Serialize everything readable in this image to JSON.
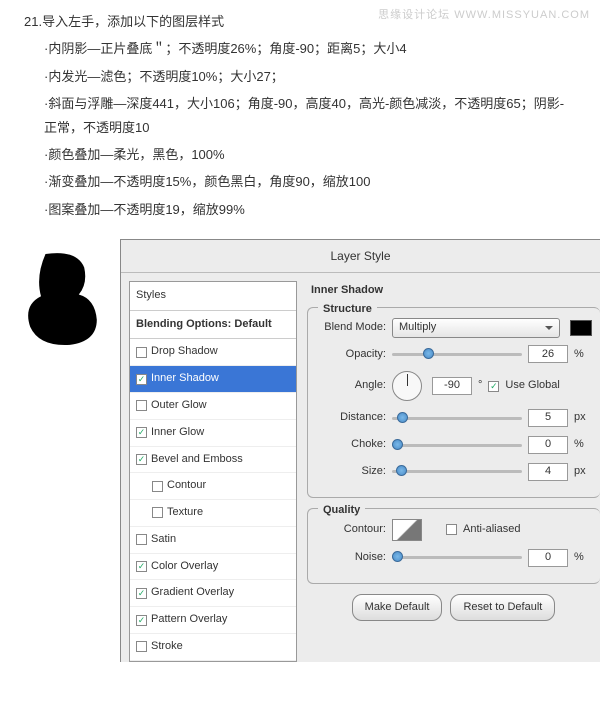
{
  "watermark": "思缘设计论坛  WWW.MISSYUAN.COM",
  "step_title": "21.导入左手，添加以下的图层样式",
  "bullets": [
    "·内阴影—正片叠底＂；不透明度26%；角度-90；距离5；大小4",
    "·内发光—滤色；不透明度10%；大小27；",
    "·斜面与浮雕—深度441，大小106；角度-90，高度40，高光-颜色减淡，不透明度65；阴影-正常，不透明度10",
    "·颜色叠加—柔光，黑色，100%",
    "·渐变叠加—不透明度15%，颜色黑白，角度90，缩放100",
    "·图案叠加—不透明度19，缩放99%"
  ],
  "dialog": {
    "title": "Layer Style",
    "styles_header": "Styles",
    "blending_default": "Blending Options: Default",
    "items": [
      {
        "label": "Drop Shadow",
        "checked": false,
        "active": false,
        "sub": false
      },
      {
        "label": "Inner Shadow",
        "checked": true,
        "active": true,
        "sub": false
      },
      {
        "label": "Outer Glow",
        "checked": false,
        "active": false,
        "sub": false
      },
      {
        "label": "Inner Glow",
        "checked": true,
        "active": false,
        "sub": false
      },
      {
        "label": "Bevel and Emboss",
        "checked": true,
        "active": false,
        "sub": false
      },
      {
        "label": "Contour",
        "checked": false,
        "active": false,
        "sub": true
      },
      {
        "label": "Texture",
        "checked": false,
        "active": false,
        "sub": true
      },
      {
        "label": "Satin",
        "checked": false,
        "active": false,
        "sub": false
      },
      {
        "label": "Color Overlay",
        "checked": true,
        "active": false,
        "sub": false
      },
      {
        "label": "Gradient Overlay",
        "checked": true,
        "active": false,
        "sub": false
      },
      {
        "label": "Pattern Overlay",
        "checked": true,
        "active": false,
        "sub": false
      },
      {
        "label": "Stroke",
        "checked": false,
        "active": false,
        "sub": false
      }
    ],
    "section": "Inner Shadow",
    "structure": "Structure",
    "quality": "Quality",
    "labels": {
      "blend_mode": "Blend Mode:",
      "opacity": "Opacity:",
      "angle": "Angle:",
      "use_global": "Use Global",
      "distance": "Distance:",
      "choke": "Choke:",
      "size": "Size:",
      "contour": "Contour:",
      "anti": "Anti-aliased",
      "noise": "Noise:"
    },
    "values": {
      "blend_mode": "Multiply",
      "opacity": "26",
      "opacity_unit": "%",
      "angle": "-90",
      "use_global": true,
      "distance": "5",
      "distance_unit": "px",
      "choke": "0",
      "choke_unit": "%",
      "size": "4",
      "size_unit": "px",
      "anti": false,
      "noise": "0",
      "noise_unit": "%"
    },
    "buttons": {
      "make_default": "Make Default",
      "reset": "Reset to Default"
    }
  }
}
